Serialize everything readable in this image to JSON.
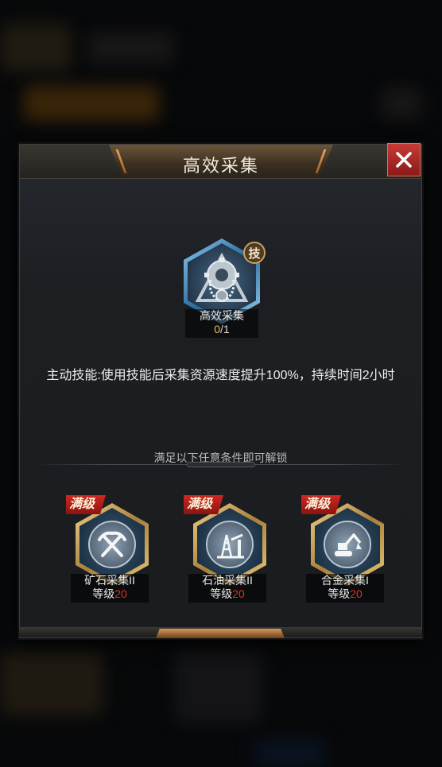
{
  "dialog": {
    "title": "高效采集",
    "close_icon": "close-icon"
  },
  "main_skill": {
    "icon": "gear-chain-icon",
    "badge": "技",
    "name": "高效采集",
    "progress_current": "0",
    "progress_total": "/1",
    "description": "主动技能:使用技能后采集资源速度提升100%，持续时间2小时"
  },
  "unlock_hint": "满足以下任意条件即可解锁",
  "conditions": [
    {
      "icon": "crossed-pickaxes-icon",
      "tag": "满级",
      "name": "矿石采集II",
      "level_label": "等级",
      "level_value": "20"
    },
    {
      "icon": "oil-derrick-icon",
      "tag": "满级",
      "name": "石油采集II",
      "level_label": "等级",
      "level_value": "20"
    },
    {
      "icon": "excavator-icon",
      "tag": "满级",
      "name": "合金采集I",
      "level_label": "等级",
      "level_value": "20"
    }
  ],
  "colors": {
    "accent_gold": "#c8a060",
    "close_red": "#c83a36",
    "progress_yellow": "#e8c04a",
    "level_red": "#e0302a"
  }
}
